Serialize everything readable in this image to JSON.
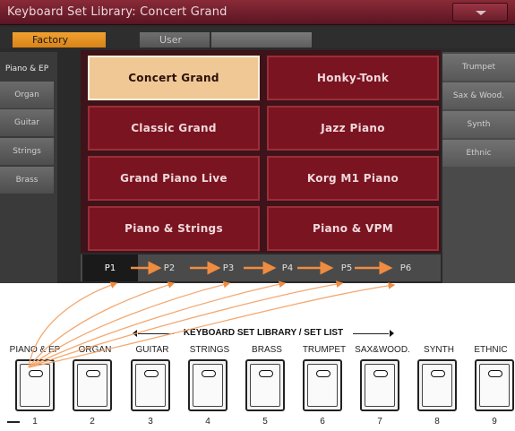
{
  "title": "Keyboard Set Library: Concert Grand",
  "tabs": {
    "factory": "Factory",
    "user": "User",
    "blank": ""
  },
  "left_categories": [
    "Piano & EP",
    "Organ",
    "Guitar",
    "Strings",
    "Brass"
  ],
  "right_categories": [
    "Trumpet",
    "Sax & Wood.",
    "Synth",
    "Ethnic"
  ],
  "sounds": [
    {
      "label": "Concert Grand",
      "selected": true
    },
    {
      "label": "Honky-Tonk",
      "selected": false
    },
    {
      "label": "Classic Grand",
      "selected": false
    },
    {
      "label": "Jazz Piano",
      "selected": false
    },
    {
      "label": "Grand Piano Live",
      "selected": false
    },
    {
      "label": "Korg M1 Piano",
      "selected": false
    },
    {
      "label": "Piano & Strings",
      "selected": false
    },
    {
      "label": "Piano & VPM",
      "selected": false
    }
  ],
  "pages": [
    "P1",
    "P2",
    "P3",
    "P4",
    "P5",
    "P6"
  ],
  "active_page": "P1",
  "panel": {
    "title": "KEYBOARD SET LIBRARY / SET LIST",
    "buttons": [
      {
        "label": "PIANO & EP",
        "num": "1"
      },
      {
        "label": "ORGAN",
        "num": "2"
      },
      {
        "label": "GUITAR",
        "num": "3"
      },
      {
        "label": "STRINGS",
        "num": "4"
      },
      {
        "label": "BRASS",
        "num": "5"
      },
      {
        "label": "TRUMPET",
        "num": "6"
      },
      {
        "label": "SAX&WOOD.",
        "num": "7"
      },
      {
        "label": "SYNTH",
        "num": "8"
      },
      {
        "label": "ETHNIC",
        "num": "9"
      }
    ]
  },
  "colors": {
    "accent": "#f08c40",
    "selected_sound": "#f0c896",
    "sound_bg": "#7a1420"
  }
}
